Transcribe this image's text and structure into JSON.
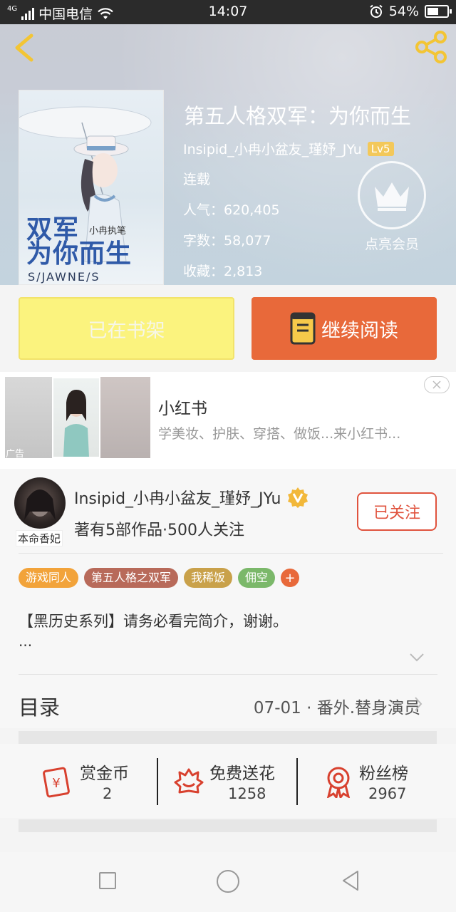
{
  "status_bar": {
    "network": "4G",
    "carrier": "中国电信",
    "time": "14:07",
    "battery": "54%"
  },
  "book": {
    "title": "第五人格双军：为你而生",
    "author": "Insipid_小冉小盆友_瑾妤_JYu",
    "level": "Lv5",
    "status": "连载",
    "popularity": "人气：620,405",
    "word_count": "字数：58,077",
    "favorites": "收藏：2,813",
    "vip_label": "点亮会员",
    "cover": {
      "title_line1": "双军",
      "title_line2": "为你而生",
      "author": "小冉执笔",
      "subtitle": "S/JAWNE/S"
    }
  },
  "actions": {
    "shelf_label": "已在书架",
    "read_label": "继续阅读"
  },
  "ad": {
    "title": "小红书",
    "description": "学美妆、护肤、穿搭、做饭...来小红书...",
    "tag": "广告"
  },
  "author_card": {
    "name": "Insipid_小冉小盆友_瑾妤_JYu",
    "avatar_tag": "本命香妃",
    "stats": "著有5部作品·500人关注",
    "follow_label": "已关注",
    "tags": [
      {
        "label": "游戏同人",
        "color": "#f2a33a"
      },
      {
        "label": "第五人格之双军",
        "color": "#b86a5a"
      },
      {
        "label": "我稀饭",
        "color": "#c9a14a"
      },
      {
        "label": "佣空",
        "color": "#7bb86a"
      }
    ],
    "tag_more": "+",
    "summary": "【黑历史系列】请务必看完简介，谢谢。",
    "summary_more": "...",
    "toc_label": "目录",
    "toc_latest": "07-01 · 番外.替身演员"
  },
  "gifts": [
    {
      "label": "赏金币",
      "count": "2",
      "icon": "red-envelope-icon"
    },
    {
      "label": "免费送花",
      "count": "1258",
      "icon": "flower-icon"
    },
    {
      "label": "粉丝榜",
      "count": "2967",
      "icon": "medal-icon"
    }
  ],
  "colors": {
    "accent": "#e8693a",
    "shelf_yellow": "#fbf37e",
    "follow_red": "#e0533e",
    "icon_red": "#d8412f"
  }
}
